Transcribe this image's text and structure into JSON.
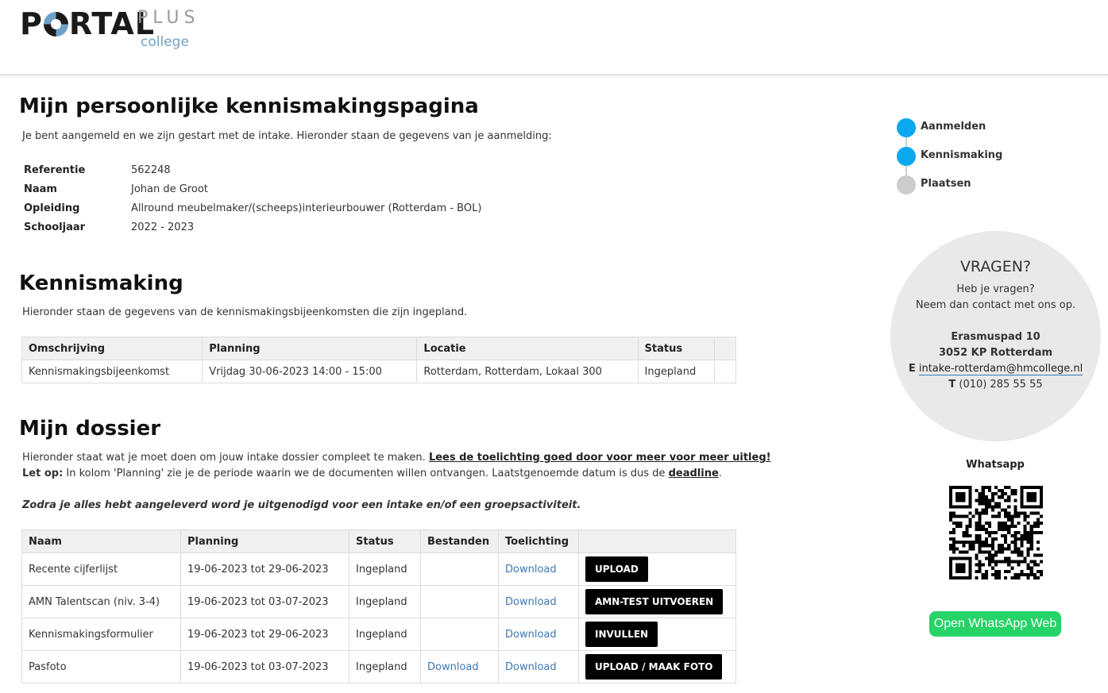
{
  "brand": {
    "portal_pre": "P",
    "portal_post": "RTAL",
    "plus": "PLUS",
    "college": "college"
  },
  "intro": {
    "title": "Mijn persoonlijke kennismakingspagina",
    "text": "Je bent aangemeld en we zijn gestart met de intake. Hieronder staan de gegevens van je aanmelding:",
    "fields": [
      {
        "label": "Referentie",
        "value": "562248"
      },
      {
        "label": "Naam",
        "value": "Johan de Groot"
      },
      {
        "label": "Opleiding",
        "value": "Allround meubelmaker/(scheeps)interieurbouwer (Rotterdam - BOL)"
      },
      {
        "label": "Schooljaar",
        "value": "2022 - 2023"
      }
    ]
  },
  "kennismaking": {
    "title": "Kennismaking",
    "text": "Hieronder staan de gegevens van de kennismakingsbijeenkomsten die zijn ingepland.",
    "headers": [
      "Omschrijving",
      "Planning",
      "Locatie",
      "Status"
    ],
    "rows": [
      [
        "Kennismakingsbijeenkomst",
        "Vrijdag 30-06-2023 14:00 - 15:00",
        "Rotterdam, Rotterdam, Lokaal 300",
        "Ingepland"
      ]
    ]
  },
  "dossier": {
    "title": "Mijn dossier",
    "line1": "Hieronder staat wat je moet doen om jouw intake dossier compleet te maken. ",
    "line1_link": "Lees de toelichting goed door voor meer voor meer uitleg!",
    "line2_bold": "Let op:",
    "line2": " In kolom 'Planning' zie je de periode waarin we de documenten willen ontvangen. Laatstgenoemde datum is dus de ",
    "line2_link": "deadline",
    "line2_end": ".",
    "note": "Zodra je alles hebt aangeleverd word je uitgenodigd voor een intake en/of een groepsactiviteit.",
    "headers": [
      "Naam",
      "Planning",
      "Status",
      "Bestanden",
      "Toelichting"
    ],
    "rows": [
      {
        "naam": "Recente cijferlijst",
        "planning": "19-06-2023 tot 29-06-2023",
        "status": "Ingepland",
        "bestanden": "",
        "toelichting": "Download",
        "action": "UPLOAD"
      },
      {
        "naam": "AMN Talentscan (niv. 3-4)",
        "planning": "19-06-2023 tot 03-07-2023",
        "status": "Ingepland",
        "bestanden": "",
        "toelichting": "Download",
        "action": "AMN-TEST UITVOEREN"
      },
      {
        "naam": "Kennismakingsformulier",
        "planning": "19-06-2023 tot 29-06-2023",
        "status": "Ingepland",
        "bestanden": "",
        "toelichting": "Download",
        "action": "INVULLEN"
      },
      {
        "naam": "Pasfoto",
        "planning": "19-06-2023 tot 03-07-2023",
        "status": "Ingepland",
        "bestanden": "Download",
        "toelichting": "Download",
        "action": "UPLOAD / MAAK FOTO"
      }
    ]
  },
  "steps": [
    {
      "label": "Aanmelden",
      "color": "#0aa8ee"
    },
    {
      "label": "Kennismaking",
      "color": "#0aa8ee"
    },
    {
      "label": "Plaatsen",
      "color": "#cccccc"
    }
  ],
  "contact": {
    "title": "VRAGEN?",
    "line1": "Heb je vragen?",
    "line2": "Neem dan contact met ons op.",
    "street": "Erasmuspad 10",
    "city": "3052 KP Rotterdam",
    "email_label": "E",
    "email": "intake-rotterdam@hmcollege.nl",
    "phone_label": "T",
    "phone": "(010) 285 55 55"
  },
  "whatsapp": {
    "title": "Whatsapp",
    "button": "Open WhatsApp Web"
  }
}
